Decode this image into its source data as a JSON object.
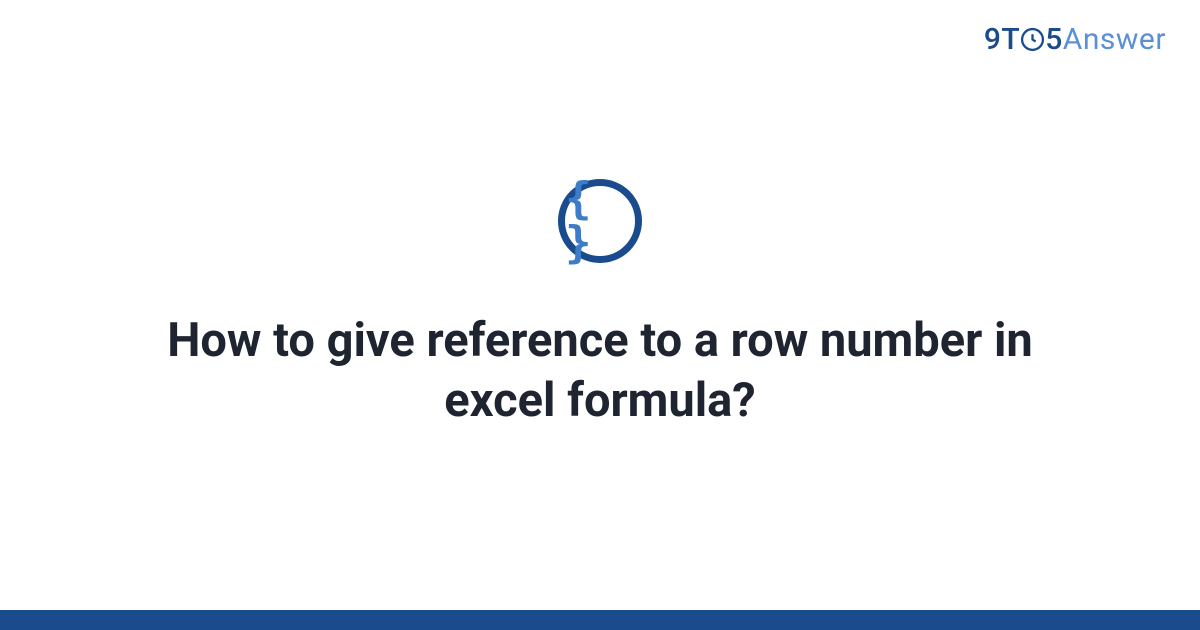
{
  "brand": {
    "part1": "9T",
    "part2": "5",
    "part3": "Answer"
  },
  "icon": {
    "glyph": "{ }",
    "name": "code-braces-icon"
  },
  "title": "How to give reference to a row number in excel formula?",
  "colors": {
    "primary": "#1a4b8c",
    "accent": "#5b8fd6",
    "text": "#1e2430"
  }
}
